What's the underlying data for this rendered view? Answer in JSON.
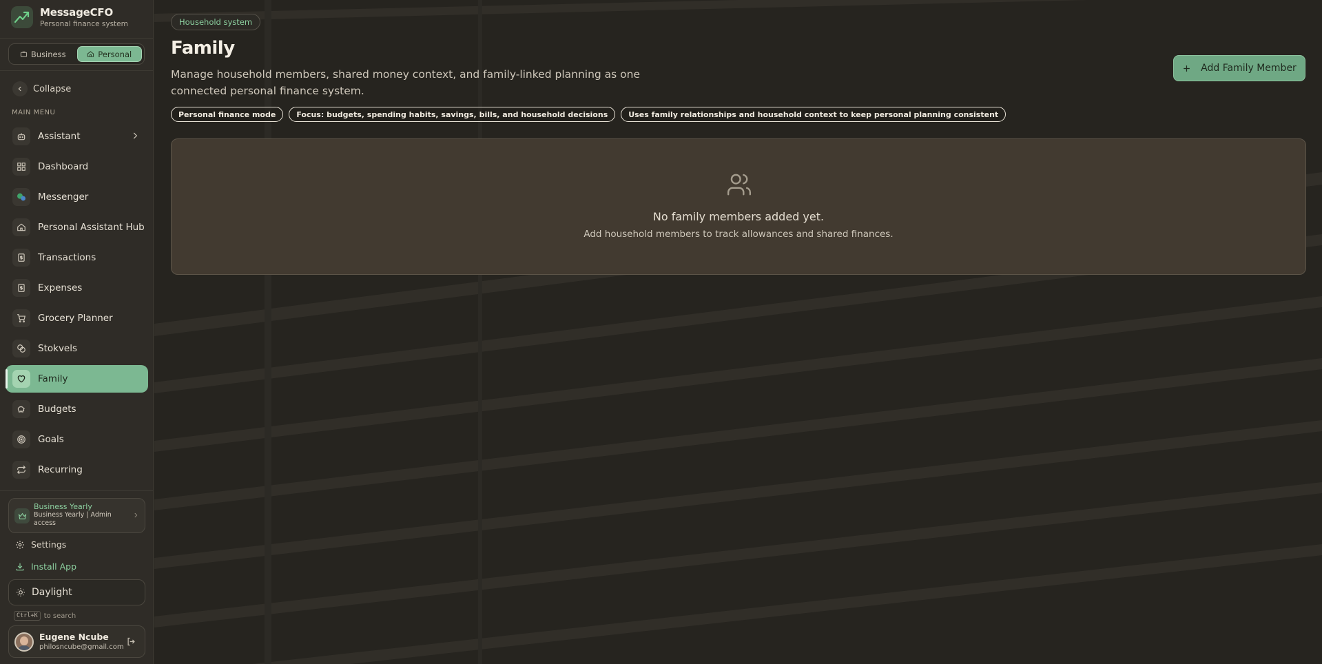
{
  "brand": {
    "name": "MessageCFO",
    "subtitle": "Personal finance system"
  },
  "mode_switch": {
    "business_label": "Business",
    "personal_label": "Personal",
    "active": "Personal"
  },
  "sidebar": {
    "collapse_label": "Collapse",
    "menu_heading": "MAIN MENU",
    "items": [
      {
        "label": "Assistant",
        "icon": "bot-icon",
        "has_submenu": true
      },
      {
        "label": "Dashboard",
        "icon": "grid-icon"
      },
      {
        "label": "Messenger",
        "icon": "messenger-icon"
      },
      {
        "label": "Personal Assistant Hub",
        "icon": "home-icon"
      },
      {
        "label": "Transactions",
        "icon": "dollar-receipt-icon"
      },
      {
        "label": "Expenses",
        "icon": "dollar-receipt-icon"
      },
      {
        "label": "Grocery Planner",
        "icon": "cart-icon"
      },
      {
        "label": "Stokvels",
        "icon": "coins-icon"
      },
      {
        "label": "Family",
        "icon": "heart-icon",
        "active": true
      },
      {
        "label": "Budgets",
        "icon": "piggy-bank-icon"
      },
      {
        "label": "Goals",
        "icon": "target-icon"
      },
      {
        "label": "Recurring",
        "icon": "repeat-icon"
      }
    ],
    "plan": {
      "title": "Business Yearly",
      "description": "Business Yearly | Admin access"
    },
    "settings_label": "Settings",
    "install_label": "Install App",
    "theme_label": "Daylight",
    "search_hint": {
      "shortcut": "Ctrl+K",
      "text": "to search"
    },
    "user": {
      "name": "Eugene Ncube",
      "email": "philosncube@gmail.com"
    }
  },
  "header": {
    "breadcrumb": "Household system",
    "title": "Family",
    "description": "Manage household members, shared money context, and family-linked planning as one connected personal finance system.",
    "add_button_label": "Add Family Member",
    "tags": [
      "Personal finance mode",
      "Focus: budgets, spending habits, savings, bills, and household decisions",
      "Uses family relationships and household context to keep personal planning consistent"
    ]
  },
  "empty_state": {
    "icon": "users-icon",
    "title": "No family members added yet.",
    "subtitle": "Add household members to track allowances and shared finances."
  },
  "colors": {
    "accent": "#7cb892",
    "accent_text": "#8ccf9f",
    "sidebar_bg": "#2f2c27",
    "main_bg": "#26241f",
    "card_bg": "#423a30"
  }
}
